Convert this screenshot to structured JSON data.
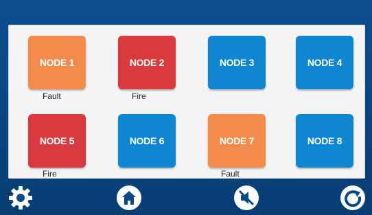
{
  "colors": {
    "frame": "#0a4a86",
    "panel": "#f4f4f4",
    "fault": "#f28b4b",
    "fire": "#d93a3f",
    "normal": "#0f86d2"
  },
  "nodes": [
    {
      "label": "NODE 1",
      "status": "Fault",
      "color": "#f28b4b"
    },
    {
      "label": "NODE 2",
      "status": "Fire",
      "color": "#d93a3f"
    },
    {
      "label": "NODE 3",
      "status": "",
      "color": "#0f86d2"
    },
    {
      "label": "NODE 4",
      "status": "",
      "color": "#0f86d2"
    },
    {
      "label": "NODE 5",
      "status": "Fire",
      "color": "#d93a3f"
    },
    {
      "label": "NODE 6",
      "status": "",
      "color": "#0f86d2"
    },
    {
      "label": "NODE 7",
      "status": "Fault",
      "color": "#f28b4b"
    },
    {
      "label": "NODE 8",
      "status": "",
      "color": "#0f86d2"
    }
  ],
  "bottom_bar": {
    "settings_icon": "gear-icon",
    "home_icon": "home-icon",
    "mute_icon": "speaker-muted-icon",
    "refresh_icon": "refresh-icon"
  }
}
